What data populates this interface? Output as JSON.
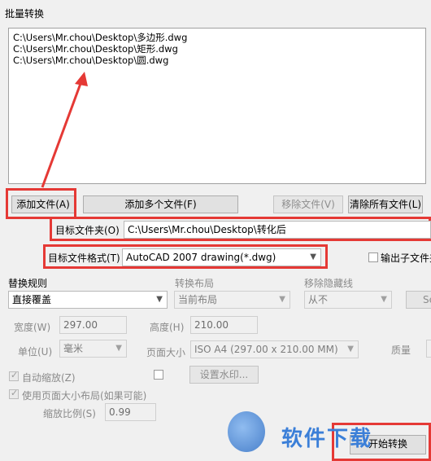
{
  "window": {
    "title": "批量转换"
  },
  "file_list": [
    "C:\\Users\\Mr.chou\\Desktop\\多边形.dwg",
    "C:\\Users\\Mr.chou\\Desktop\\矩形.dwg",
    "C:\\Users\\Mr.chou\\Desktop\\圆.dwg"
  ],
  "buttons": {
    "add_file": "添加文件(A)",
    "add_multiple": "添加多个文件(F)",
    "remove_file": "移除文件(V)",
    "clear_all": "清除所有文件(L)",
    "set_watermark": "设置水印...",
    "start_convert": "开始转换",
    "side_button": "Se"
  },
  "target": {
    "folder_label": "目标文件夹(O)",
    "folder_value": "C:\\Users\\Mr.chou\\Desktop\\转化后",
    "format_label": "目标文件格式(T)",
    "format_value": "AutoCAD 2007 drawing(*.dwg)",
    "output_subfolder_label": "输出子文件夹"
  },
  "rules": {
    "replace_rule_label": "替换规则",
    "replace_rule_value": "直接覆盖",
    "convert_layout_label": "转换布局",
    "convert_layout_value": "当前布局",
    "remove_hidden_label": "移除隐藏线",
    "remove_hidden_value": "从不"
  },
  "page": {
    "width_label": "宽度(W)",
    "width_value": "297.00",
    "height_label": "高度(H)",
    "height_value": "210.00",
    "unit_label": "单位(U)",
    "unit_value": "毫米",
    "page_size_label": "页面大小",
    "page_size_value": "ISO A4 (297.00 x 210.00 MM)",
    "quality_label": "质量",
    "auto_zoom_label": "自动缩放(Z)",
    "use_page_layout_label": "使用页面大小布局(如果可能)",
    "scale_label": "缩放比例(S)",
    "scale_value": "0.99"
  },
  "watermark": {
    "text": "软件下载"
  },
  "colors": {
    "highlight": "#e53935",
    "watermark": "#3b7fd8"
  }
}
